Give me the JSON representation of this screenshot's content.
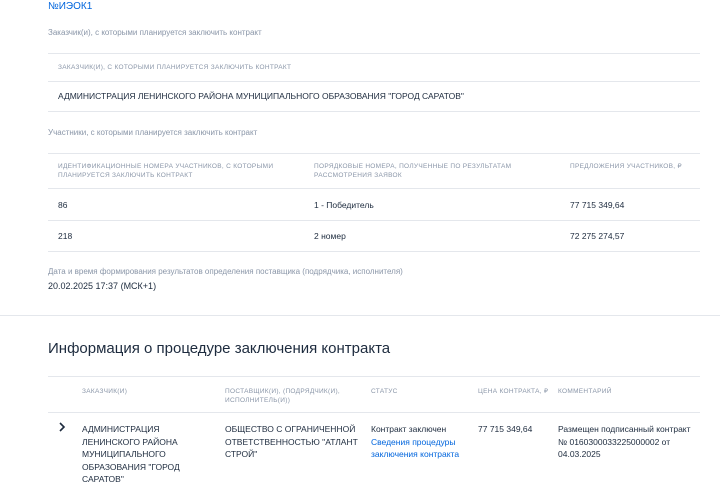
{
  "top_link": "№ИЭОК1",
  "customers_section": {
    "label": "Заказчик(и), с которыми планируется заключить контракт",
    "table_header": "ЗАКАЗЧИК(И), С КОТОРЫМИ ПЛАНИРУЕТСЯ ЗАКЛЮЧИТЬ КОНТРАКТ",
    "customer_name": "АДМИНИСТРАЦИЯ ЛЕНИНСКОГО РАЙОНА МУНИЦИПАЛЬНОГО ОБРАЗОВАНИЯ \"ГОРОД САРАТОВ\""
  },
  "participants_section": {
    "label": "Участники, с которыми планируется заключить контракт",
    "headers": {
      "ids": "ИДЕНТИФИКАЦИОННЫЕ НОМЕРА УЧАСТНИКОВ, С КОТОРЫМИ ПЛАНИРУЕТСЯ ЗАКЛЮЧИТЬ КОНТРАКТ",
      "ranks": "ПОРЯДКОВЫЕ НОМЕРА, ПОЛУЧЕННЫЕ ПО РЕЗУЛЬТАТАМ РАССМОТРЕНИЯ ЗАЯВОК",
      "offers": "ПРЕДЛОЖЕНИЯ УЧАСТНИКОВ, ₽"
    },
    "rows": [
      {
        "id": "86",
        "rank": "1 - Победитель",
        "offer": "77 715 349,64"
      },
      {
        "id": "218",
        "rank": "2 номер",
        "offer": "72 275 274,57"
      }
    ]
  },
  "datetime_section": {
    "label": "Дата и время формирования результатов определения поставщика (подрядчика, исполнителя)",
    "value": "20.02.2025 17:37 (МСК+1)"
  },
  "contract_section": {
    "title": "Информация о процедуре заключения контракта",
    "headers": {
      "customer": "ЗАКАЗЧИК(И)",
      "supplier": "ПОСТАВЩИК(И), (ПОДРЯДЧИК(И), ИСПОЛНИТЕЛЬ(И))",
      "status": "СТАТУС",
      "price": "ЦЕНА КОНТРАКТА, ₽",
      "comment": "КОММЕНТАРИЙ"
    },
    "row": {
      "customer": "АДМИНИСТРАЦИЯ ЛЕНИНСКОГО РАЙОНА МУНИЦИПАЛЬНОГО ОБРАЗОВАНИЯ \"ГОРОД САРАТОВ\"",
      "supplier": "ОБЩЕСТВО С ОГРАНИЧЕННОЙ ОТВЕТСТВЕННОСТЬЮ \"АТЛАНТ СТРОЙ\"",
      "status": "Контракт заключен",
      "status_link": "Сведения процедуры заключения контракта",
      "price": "77 715 349,64",
      "comment": "Размещен подписанный контракт № 0160300033225000002 от 04.03.2025"
    }
  },
  "colors": {
    "link": "#0065dd",
    "text": "#1d2b3e",
    "muted": "#8a96a8",
    "divider": "#e4e7ec"
  }
}
